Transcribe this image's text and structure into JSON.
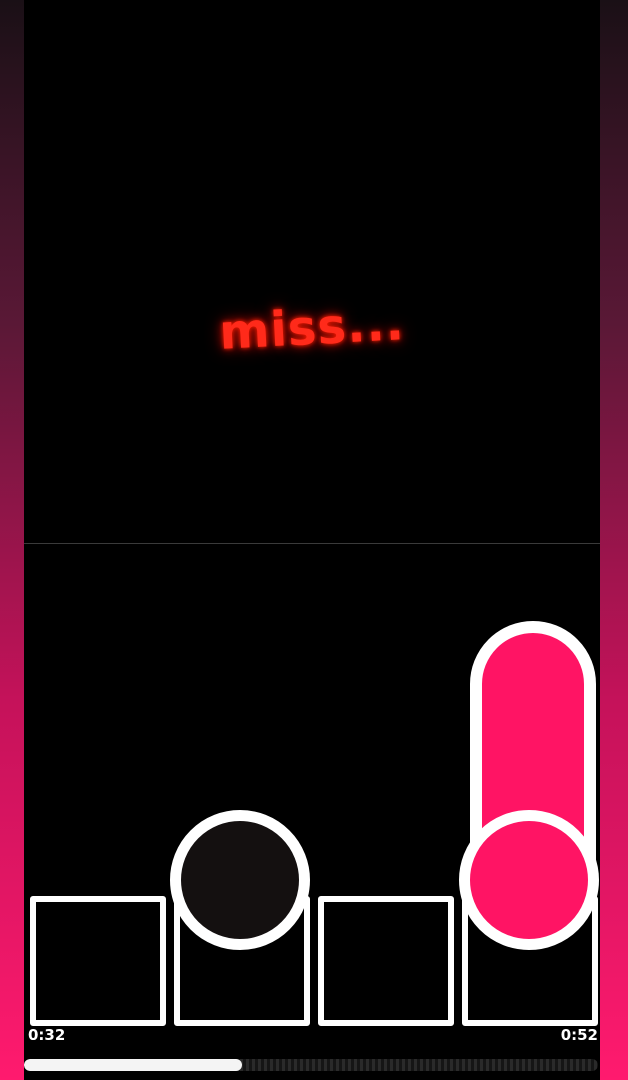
{
  "feedback": {
    "text": "miss..."
  },
  "lanes": [
    {
      "index": 1
    },
    {
      "index": 2
    },
    {
      "index": 3
    },
    {
      "index": 4
    }
  ],
  "notes": [
    {
      "type": "tap",
      "lane": 2,
      "color": "#141010"
    },
    {
      "type": "hold",
      "lane": 4,
      "color": "#ff1464"
    }
  ],
  "timer": {
    "elapsed": "0:32",
    "total": "0:52",
    "progress_fraction": 0.38
  },
  "colors": {
    "accent": "#ff1464",
    "miss": "#ff2a1a",
    "outline": "#ffffff",
    "background": "#000000"
  }
}
